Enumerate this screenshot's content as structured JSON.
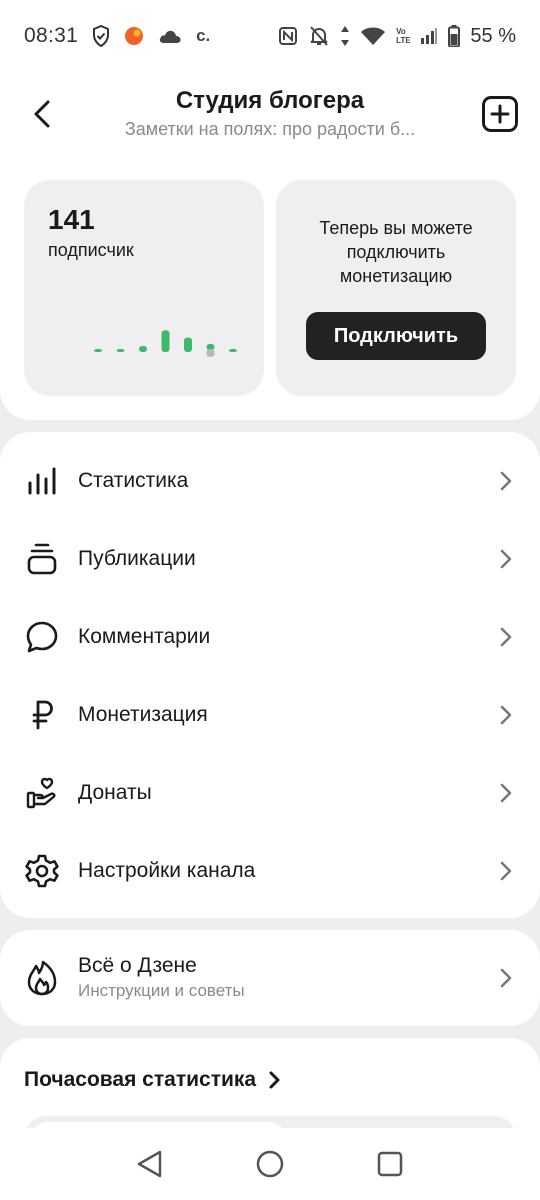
{
  "status_bar": {
    "time": "08:31",
    "carrier_mark": "c.",
    "battery": "55 %",
    "volte": "Vo LTE",
    "icons": [
      "shield-icon",
      "orange-app-icon",
      "cloud-icon",
      "nfc-icon",
      "bell-off-icon",
      "data-arrows-icon",
      "wifi-icon",
      "signal-icon",
      "battery-icon"
    ]
  },
  "header": {
    "title": "Студия блогера",
    "subtitle": "Заметки на полях: про радости б..."
  },
  "subscribers": {
    "count": "141",
    "label": "подписчик",
    "trend": [
      0.1,
      0.1,
      0.25,
      0.9,
      0.6,
      -0.2,
      0.1
    ]
  },
  "monetization_promo": {
    "text": "Теперь вы можете подключить монетизацию",
    "button": "Подключить"
  },
  "menu": [
    {
      "label": "Статистика",
      "icon": "bar-chart-icon"
    },
    {
      "label": "Публикации",
      "icon": "stack-icon"
    },
    {
      "label": "Комментарии",
      "icon": "comment-icon"
    },
    {
      "label": "Монетизация",
      "icon": "ruble-icon"
    },
    {
      "label": "Донаты",
      "icon": "hand-heart-icon"
    },
    {
      "label": "Настройки канала",
      "icon": "gear-icon"
    }
  ],
  "about": {
    "title": "Всё о Дзене",
    "subtitle": "Инструкции и советы",
    "icon": "flame-icon"
  },
  "hourly": {
    "title": "Почасовая статистика"
  },
  "colors": {
    "accent_green": "#3cba6a",
    "bar_gray": "#b8b8b8",
    "dark": "#222222",
    "card_bg": "#efeff1"
  }
}
